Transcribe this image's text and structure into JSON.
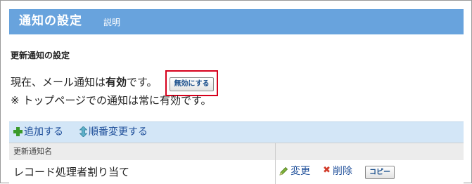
{
  "header": {
    "title": "通知の設定",
    "help_link": "説明"
  },
  "section": {
    "title": "更新通知の設定"
  },
  "status": {
    "prefix": "現在、メール通知は",
    "state": "有効",
    "suffix": "です。",
    "disable_button": "無効にする",
    "note": "※ トップページでの通知は常に有効です。"
  },
  "toolbar": {
    "add_label": "追加する",
    "reorder_label": "順番変更する"
  },
  "table": {
    "columns": [
      "更新通知名",
      ""
    ],
    "rows": [
      {
        "name": "レコード処理者割り当て",
        "edit_label": "変更",
        "delete_label": "削除",
        "copy_label": "コピー"
      }
    ]
  },
  "colors": {
    "header_bg": "#68a3dd",
    "toolbar_bg": "#d3e6f7",
    "link": "#1f4f9a",
    "highlight": "#d6001c",
    "add_icon": "#3a9a2a",
    "delete_icon": "#d23b2a"
  },
  "icons": {
    "add": "plus-icon",
    "reorder": "up-down-arrows-icon",
    "edit": "pencil-icon",
    "delete": "x-icon"
  }
}
